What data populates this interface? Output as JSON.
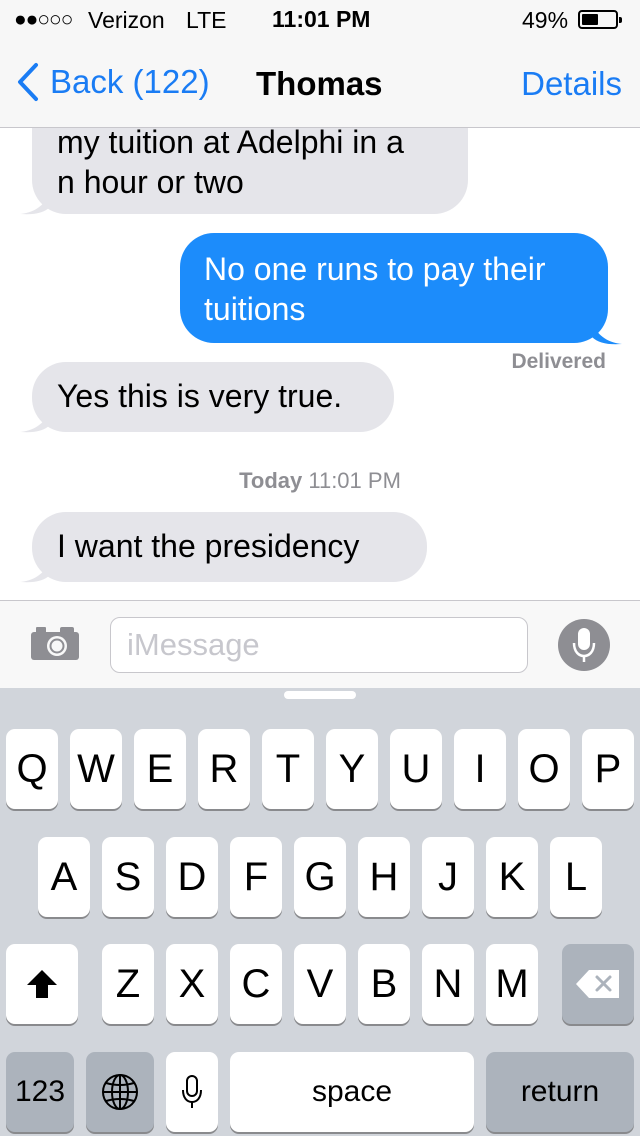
{
  "status_bar": {
    "signal": "●●○○○",
    "carrier": "Verizon",
    "network": "LTE",
    "time": "11:01 PM",
    "battery_percent": "49%",
    "battery_level": 0.49
  },
  "nav": {
    "back_label": "Back (122)",
    "title": "Thomas",
    "details_label": "Details"
  },
  "messages": {
    "m1": {
      "lines": [
        "my tuition at Adelphi in a",
        "n hour or two"
      ],
      "direction": "received"
    },
    "m2": {
      "lines": [
        "No one runs to pay their",
        "tuitions"
      ],
      "direction": "sent"
    },
    "delivered": "Delivered",
    "m3": {
      "text": "Yes this is very true.",
      "direction": "received"
    },
    "timestamp_day": "Today",
    "timestamp_time": "11:01 PM",
    "m4": {
      "text": "I want the presidency",
      "direction": "received"
    }
  },
  "composer": {
    "placeholder": "iMessage",
    "camera_icon": "camera-icon",
    "mic_icon": "microphone-icon"
  },
  "keyboard": {
    "row1": [
      "Q",
      "W",
      "E",
      "R",
      "T",
      "Y",
      "U",
      "I",
      "O",
      "P"
    ],
    "row2": [
      "A",
      "S",
      "D",
      "F",
      "G",
      "H",
      "J",
      "K",
      "L"
    ],
    "row3": [
      "Z",
      "X",
      "C",
      "V",
      "B",
      "N",
      "M"
    ],
    "shift_icon": "shift-arrow-icon",
    "delete_icon": "backspace-icon",
    "numbers_label": "123",
    "globe_icon": "globe-icon",
    "dictation_icon": "microphone-icon",
    "space_label": "space",
    "return_label": "return"
  },
  "colors": {
    "accent": "#1a7cf4",
    "sent_bubble": "#1c8cfb",
    "received_bubble": "#e5e5ea",
    "keyboard_bg": "#d1d5db"
  }
}
